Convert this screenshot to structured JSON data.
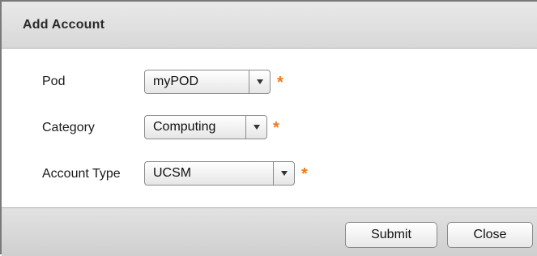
{
  "dialog": {
    "title": "Add Account"
  },
  "form": {
    "pod": {
      "label": "Pod",
      "value": "myPOD",
      "required_mark": "*"
    },
    "category": {
      "label": "Category",
      "value": "Computing",
      "required_mark": "*"
    },
    "account_type": {
      "label": "Account Type",
      "value": "UCSM",
      "required_mark": "*"
    }
  },
  "footer": {
    "submit_label": "Submit",
    "close_label": "Close"
  },
  "icons": {
    "dropdown": "chevron-down-icon",
    "required": "asterisk-icon"
  },
  "colors": {
    "required": "#f0781e"
  }
}
